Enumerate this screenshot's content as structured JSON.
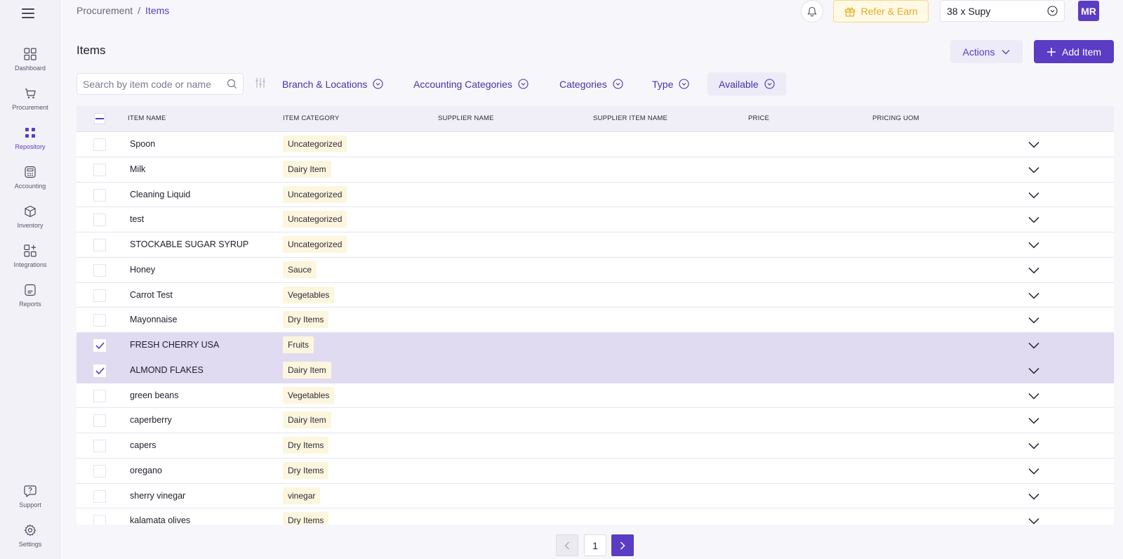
{
  "sidebar": {
    "items": [
      {
        "label": "Dashboard",
        "icon": "dashboard-icon"
      },
      {
        "label": "Procurement",
        "icon": "cart-icon"
      },
      {
        "label": "Repository",
        "icon": "repository-icon"
      },
      {
        "label": "Accounting",
        "icon": "calculator-icon"
      },
      {
        "label": "Inventory",
        "icon": "box-icon"
      },
      {
        "label": "Integrations",
        "icon": "integrations-icon"
      },
      {
        "label": "Reports",
        "icon": "reports-icon"
      }
    ],
    "bottom": [
      {
        "label": "Support",
        "icon": "support-icon"
      },
      {
        "label": "Settings",
        "icon": "gear-icon"
      }
    ]
  },
  "header": {
    "breadcrumb": [
      "Procurement",
      "Items"
    ],
    "separator": "/",
    "refer_label": "Refer & Earn",
    "branch": "38 x Supy",
    "avatar": "MR"
  },
  "page": {
    "title": "Items",
    "actions_label": "Actions",
    "add_label": "Add Item"
  },
  "filters": {
    "search_placeholder": "Search by item code or name",
    "items": [
      "Branch & Locations",
      "Accounting Categories",
      "Categories",
      "Type",
      "Available"
    ]
  },
  "table": {
    "columns": [
      "ITEM NAME",
      "ITEM CATEGORY",
      "SUPPLIER NAME",
      "SUPPLIER ITEM NAME",
      "PRICE",
      "PRICING UOM"
    ],
    "rows": [
      {
        "name": "Spoon",
        "category": "Uncategorized",
        "selected": false
      },
      {
        "name": "Milk",
        "category": "Dairy Item",
        "selected": false
      },
      {
        "name": "Cleaning Liquid",
        "category": "Uncategorized",
        "selected": false
      },
      {
        "name": "test",
        "category": "Uncategorized",
        "selected": false
      },
      {
        "name": "STOCKABLE SUGAR SYRUP",
        "category": "Uncategorized",
        "selected": false
      },
      {
        "name": "Honey",
        "category": "Sauce",
        "selected": false
      },
      {
        "name": "Carrot Test",
        "category": "Vegetables",
        "selected": false
      },
      {
        "name": "Mayonnaise",
        "category": "Dry Items",
        "selected": false
      },
      {
        "name": "FRESH CHERRY USA",
        "category": "Fruits",
        "selected": true
      },
      {
        "name": "ALMOND FLAKES",
        "category": "Dairy Item",
        "selected": true
      },
      {
        "name": "green beans",
        "category": "Vegetables",
        "selected": false
      },
      {
        "name": "caperberry",
        "category": "Dairy Item",
        "selected": false
      },
      {
        "name": "capers",
        "category": "Dry Items",
        "selected": false
      },
      {
        "name": "oregano",
        "category": "Dry Items",
        "selected": false
      },
      {
        "name": "sherry vinegar",
        "category": "vinegar",
        "selected": false
      },
      {
        "name": "kalamata olives",
        "category": "Dry Items",
        "selected": false
      }
    ]
  },
  "pagination": {
    "current_page": "1"
  },
  "colors": {
    "accent": "#5b3cc4",
    "selected_row": "#e0dbf1",
    "badge_bg": "#fdf6de",
    "refer": "#e6ad1f"
  }
}
